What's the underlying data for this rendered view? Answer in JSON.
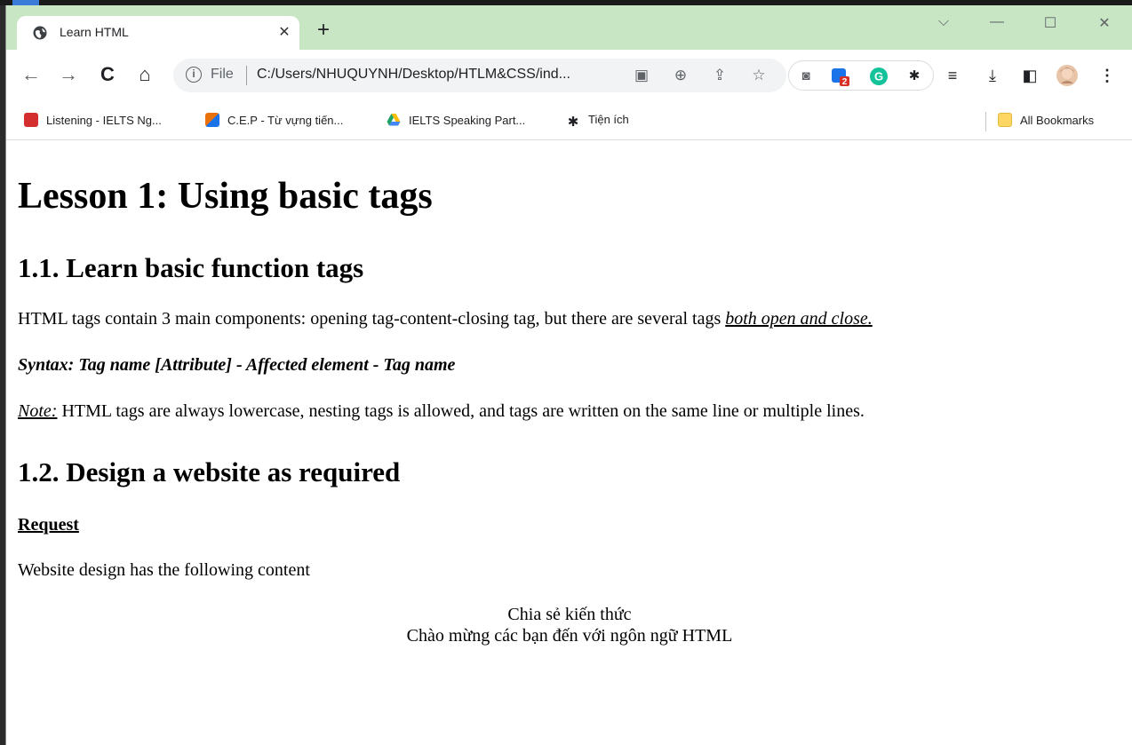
{
  "browser": {
    "tab": {
      "title": "Learn HTML"
    },
    "omnibox": {
      "scheme_label": "File",
      "url": "C:/Users/NHUQUYNH/Desktop/HTLM&CSS/ind..."
    },
    "extensions": {
      "badge_count": "2"
    },
    "bookmarks": [
      {
        "label": "Listening - IELTS Ng...",
        "icon": "ielts-icon",
        "color": "#d32f2f"
      },
      {
        "label": "C.E.P - Từ vựng tiến...",
        "icon": "cep-icon",
        "color": "#e8710a"
      },
      {
        "label": "IELTS Speaking Part...",
        "icon": "google-drive-icon",
        "color": "#1a73e8"
      },
      {
        "label": "Tiện ích",
        "icon": "puzzle-icon",
        "color": "#202124"
      }
    ],
    "all_bookmarks": "All Bookmarks"
  },
  "page": {
    "h1": "Lesson 1: Using basic tags",
    "section1": {
      "heading": "1.1. Learn basic function tags",
      "para_text": "HTML tags contain 3 main components: opening tag-content-closing tag, but there are several tags ",
      "para_link": "both open and close.",
      "syntax": "Syntax: Tag name [Attribute] - Affected element - Tag name",
      "note_label": "Note:",
      "note_text": " HTML tags are always lowercase, nesting tags is allowed, and tags are written on the same line or multiple lines."
    },
    "section2": {
      "heading": "1.2. Design a website as required",
      "request_label": "Request",
      "description": "Website design has the following content",
      "center_line1": "Chia sẻ kiến thức",
      "center_line2": "Chào mừng các bạn đến với ngôn ngữ HTML"
    }
  },
  "colors": {
    "tabstrip": "#c8e6c4",
    "accent_blue": "#1a73e8",
    "grammarly": "#15c39a"
  }
}
